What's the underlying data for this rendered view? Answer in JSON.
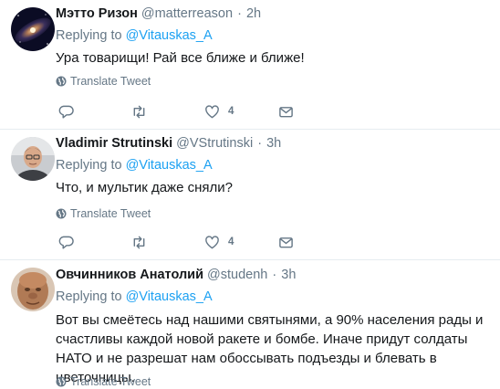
{
  "tweets": [
    {
      "name": "Мэтто Ризон",
      "handle": "@matterreason",
      "time": "2h",
      "replying_label": "Replying to",
      "replying_to": "@Vitauskas_A",
      "text": "Ура товарищи! Рай все ближе и ближе!",
      "translate": "Translate Tweet",
      "likes": "4"
    },
    {
      "name": "Vladimir Strutinski",
      "handle": "@VStrutinski",
      "time": "3h",
      "replying_label": "Replying to",
      "replying_to": "@Vitauskas_A",
      "text": "Что, и мультик даже сняли?",
      "translate": "Translate Tweet",
      "likes": "4"
    },
    {
      "name": "Овчинников Анатолий",
      "handle": "@studenh",
      "time": "3h",
      "replying_label": "Replying to",
      "replying_to": "@Vitauskas_A",
      "text": "Вот вы смеётесь над нашими святынями, а 90% населения рады и счастливы каждой новой ракете и бомбе. Иначе придут солдаты НАТО и не разрешат нам обоссывать подъезды и блевать в цветочницы.",
      "translate": "Translate Tweet"
    }
  ],
  "separator": "·",
  "colors": {
    "link": "#1da1f2",
    "muted": "#657786",
    "divider": "#e6ecf0"
  }
}
